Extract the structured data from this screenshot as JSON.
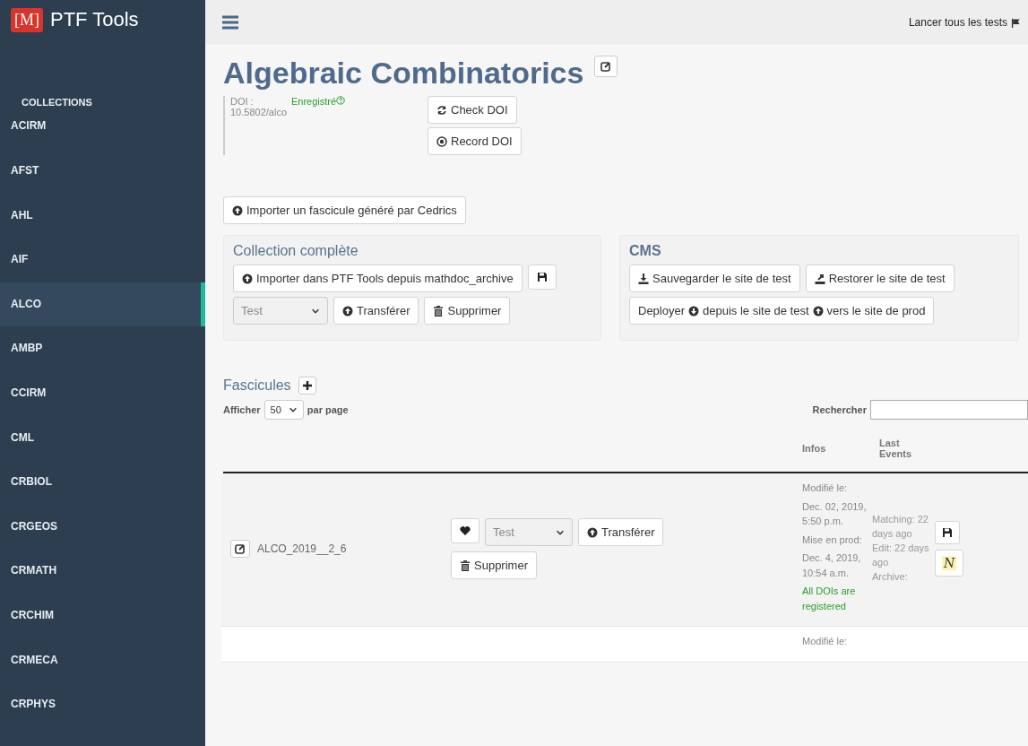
{
  "sidebar": {
    "logo": "[M]",
    "title": "PTF Tools",
    "heading": "COLLECTIONS",
    "items": [
      {
        "label": "ACIRM",
        "selected": false
      },
      {
        "label": "AFST",
        "selected": false
      },
      {
        "label": "AHL",
        "selected": false
      },
      {
        "label": "AIF",
        "selected": false
      },
      {
        "label": "ALCO",
        "selected": true
      },
      {
        "label": "AMBP",
        "selected": false
      },
      {
        "label": "CCIRM",
        "selected": false
      },
      {
        "label": "CML",
        "selected": false
      },
      {
        "label": "CRBIOL",
        "selected": false
      },
      {
        "label": "CRGEOS",
        "selected": false
      },
      {
        "label": "CRMATH",
        "selected": false
      },
      {
        "label": "CRCHIM",
        "selected": false
      },
      {
        "label": "CRMECA",
        "selected": false
      },
      {
        "label": "CRPHYS",
        "selected": false
      }
    ]
  },
  "topbar": {
    "link": "Lancer tous les tests"
  },
  "collection": {
    "title": "Algebraic Combinatorics",
    "doi_label": "DOI :",
    "doi_value": "10.5802/alco",
    "doi_status": "Enregistré",
    "buttons": [
      "Check DOI",
      "Record DOI"
    ]
  },
  "import_button": "Importer un fascicule généré par Cedrics",
  "full_collection": {
    "title": "Collection complète",
    "import_button": "Importer dans PTF Tools depuis mathdoc_archive",
    "select": "Test",
    "transfer": "Transférer",
    "delete": "Supprimer"
  },
  "cms": {
    "title": "CMS",
    "save": "Sauvegarder le site de test",
    "restore": "Restorer le site de test",
    "deploy": [
      "Deployer",
      "depuis le site de test",
      "vers le site de prod"
    ]
  },
  "fascicules": {
    "title": "Fascicules",
    "show_label": "Afficher",
    "page_size": "50",
    "per_page": "par page",
    "search_label": "Rechercher",
    "columns": [
      "Infos",
      "Last Events"
    ],
    "rows": [
      {
        "id": "ALCO_2019__2_6",
        "select": "Test",
        "transfer": "Transférer",
        "delete": "Supprimer",
        "infos": [
          "Modifié le:",
          "Dec. 02, 2019, 5:50 p.m.",
          "Mise en prod:",
          "Dec. 4, 2019, 10:54 a.m."
        ],
        "doi_status": "All DOIs are registered",
        "events": [
          "Matching: 22 days ago",
          "Edit: 22 days ago",
          "Archive:"
        ],
        "badge": "N"
      },
      {
        "infos": [
          "Modifié le:"
        ]
      }
    ]
  }
}
